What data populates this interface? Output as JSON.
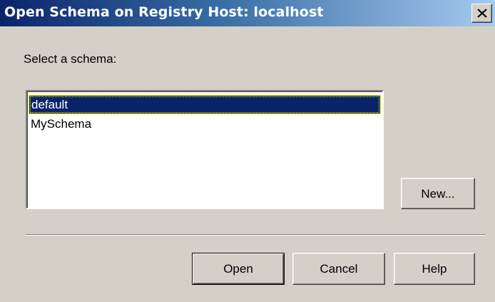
{
  "window": {
    "title": "Open Schema on Registry Host: localhost",
    "close_glyph": "X"
  },
  "content": {
    "prompt": "Select a schema:"
  },
  "schema_list": {
    "items": [
      {
        "label": "default",
        "selected": true
      },
      {
        "label": "MySchema",
        "selected": false
      }
    ]
  },
  "buttons": {
    "new_label": "New...",
    "open_label": "Open",
    "cancel_label": "Cancel",
    "help_label": "Help"
  },
  "colors": {
    "title_active": "#0a246a",
    "dialog_face": "#d4d0c8",
    "selection": "#0a246a",
    "focus_outline": "#ffff00"
  }
}
